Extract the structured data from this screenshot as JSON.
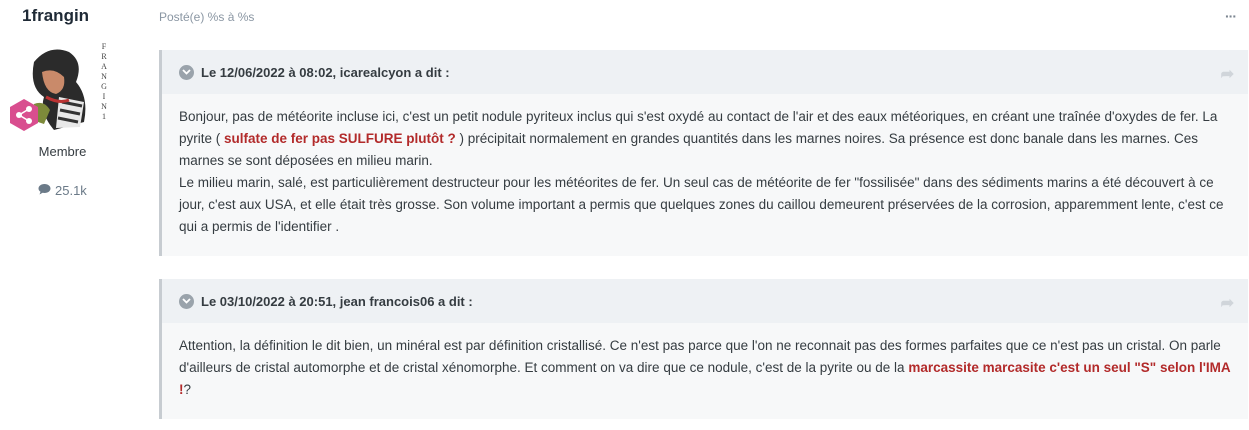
{
  "author": {
    "name": "1frangin",
    "role": "Membre",
    "post_count": "25.1k",
    "avatar_letters": [
      "F",
      "R",
      "A",
      "N",
      "G",
      "I",
      "N",
      "1"
    ]
  },
  "post": {
    "meta": "Posté(e) %s à %s",
    "menu": "···"
  },
  "quotes": [
    {
      "header": "Le 12/06/2022 à 08:02, icarealcyon a dit :",
      "p1_a": "Bonjour, pas de météorite incluse ici, c'est un petit nodule pyriteux inclus qui s'est oxydé au contact de l'air et des eaux météoriques, en créant une traînée d'oxydes de fer. La pyrite ( ",
      "p1_red": "sulfate de fer  pas SULFURE plutôt ?",
      "p1_b": " ) précipitait normalement en grandes quantités dans les marnes noires. Sa présence est donc banale dans les marnes. Ces marnes se sont déposées en milieu marin.",
      "p2": "Le milieu marin, salé, est particulièrement destructeur pour les météorites de fer. Un seul cas de météorite de fer \"fossilisée\" dans des sédiments marins a été découvert à ce jour, c'est aux USA, et elle était très grosse. Son volume important a permis que quelques zones du caillou demeurent préservées de la corrosion, apparemment lente, c'est ce qui a permis de l'identifier ."
    },
    {
      "header": "Le 03/10/2022 à 20:51, jean francois06 a dit :",
      "p1_a": "Attention, la définition le dit bien, un minéral est par définition cristallisé. Ce n'est pas parce que l'on ne reconnait pas des formes parfaites que ce n'est pas un cristal. On parle d'ailleurs de cristal automorphe et de cristal xénomorphe. Et comment on va dire que ce nodule, c'est de la pyrite ou de la ",
      "p1_red": "marcassite marcasite c'est un seul \"S\"  selon l'IMA !",
      "p1_b": "?"
    }
  ],
  "colors": {
    "accent_red": "#b22a2a",
    "badge": "#d94e8f",
    "quote_bg": "#f7f8f9",
    "quote_header_bg": "#eef1f4"
  },
  "icons": {
    "badge": "share-icon",
    "posts": "speech-bubble-icon",
    "quote_toggle": "chevron-down-icon",
    "quote_link": "share-arrow-icon"
  }
}
